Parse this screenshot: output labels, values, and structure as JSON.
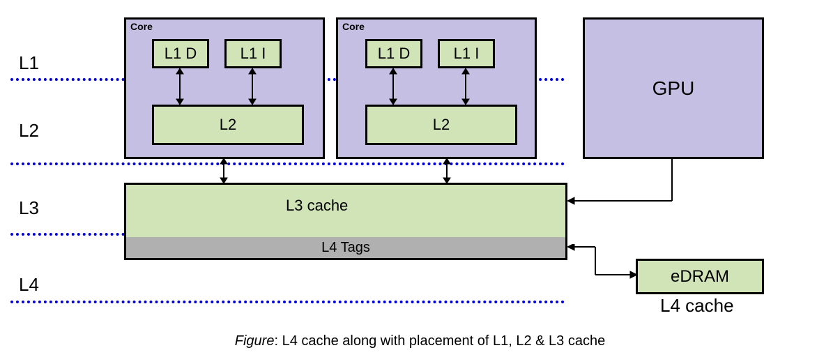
{
  "labels": {
    "l1": "L1",
    "l2": "L2",
    "l3": "L3",
    "l4": "L4",
    "core": "Core",
    "l1d": "L1 D",
    "l1i": "L1 I",
    "l2cache": "L2",
    "l3cache": "L3 cache",
    "l4tags": "L4 Tags",
    "gpu": "GPU",
    "edram": "eDRAM",
    "l4cache": "L4 cache"
  },
  "caption_prefix": "Figure",
  "caption_text": ": L4 cache along with placement of L1, L2 & L3 cache"
}
